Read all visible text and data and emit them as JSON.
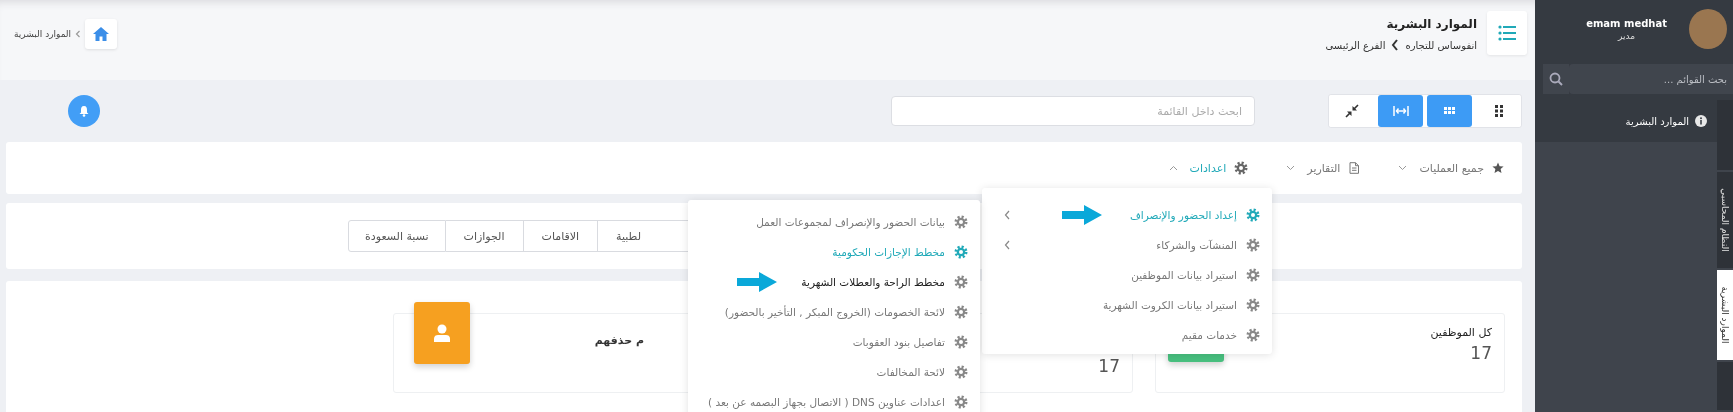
{
  "sidebar": {
    "user": {
      "name": "emam medhat",
      "role": "مدير"
    },
    "search": {
      "placeholder": "بحث القوائم ..."
    },
    "items": [
      {
        "label": "الموارد البشرية",
        "selected": true
      }
    ],
    "vertical_tabs": [
      {
        "selected": false
      },
      {
        "label": "النظام المحاسبي",
        "selected": false
      },
      {
        "label": "الموارد البشرية",
        "selected": true
      },
      {
        "selected": false
      }
    ]
  },
  "header": {
    "title": "الموارد البشرية",
    "breadcrumb": [
      "انفوساس للتجاره",
      "الفرع الرئيسى"
    ],
    "path": "الموارد البشرية"
  },
  "toolbar": {
    "view_buttons": [
      {
        "kind": "grid-large",
        "active": false
      },
      {
        "kind": "grid-small",
        "active": true
      },
      {
        "kind": "expand",
        "active": true
      },
      {
        "kind": "compress",
        "active": false
      }
    ],
    "search": {
      "placeholder": "ابحث داخل القائمة"
    }
  },
  "nav": [
    {
      "label": "جميع العمليات",
      "expanded": false
    },
    {
      "label": "التقارير",
      "expanded": false
    },
    {
      "label": "اعدادات",
      "expanded": true
    }
  ],
  "report_tabs": [
    "لطبية",
    "الاقامات",
    "الجوازات",
    "نسبة السعودة"
  ],
  "stats": [
    {
      "title": "كل الموظفين",
      "value": "17",
      "color": "#48c07f"
    },
    {
      "value": "17"
    },
    {
      "title": "م حذفهم",
      "color": "#f6a020"
    }
  ],
  "menu": [
    {
      "label": "إعداد الحضور والإنصراف",
      "submenu": true,
      "selected": true,
      "pointed": true
    },
    {
      "label": "المنشآت والشركاء",
      "submenu": true,
      "selected": false
    },
    {
      "label": "استيراد بيانات الموظفين",
      "selected": false
    },
    {
      "label": "استيراد بيانات الكروت الشهرية",
      "selected": false
    },
    {
      "label": "خدمات مقيم",
      "selected": false
    }
  ],
  "submenu": [
    {
      "label": "بيانات الحضور والإنصراف لمجموعات العمل",
      "selected": false
    },
    {
      "label": "مخطط الإجازات الحكومية",
      "selected": true
    },
    {
      "label": "مخطط الراحة والعطلات الشهرية",
      "selected": false,
      "pointed": true
    },
    {
      "label": "لائحة الخصومات (الخروج المبكر , التأخير بالحضور)",
      "selected": false
    },
    {
      "label": "تفاصيل بنود العقوبات",
      "selected": false
    },
    {
      "label": "لائحة المخالفات",
      "selected": false
    },
    {
      "label": "اعدادات عناوين DNS ( الاتصال بجهاز البصمه عن بعد )",
      "selected": false
    }
  ]
}
